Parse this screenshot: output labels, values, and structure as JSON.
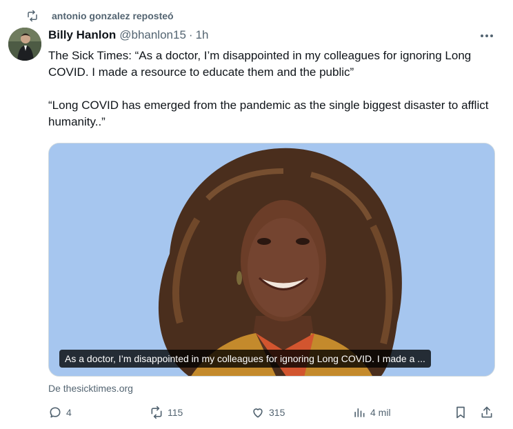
{
  "repost": {
    "text": "antonio gonzalez reposteó",
    "icon": "repost-icon"
  },
  "author": {
    "name": "Billy Hanlon",
    "handle": "@bhanlon15",
    "separator": "·",
    "time": "1h"
  },
  "tweet": {
    "paragraph1": "The Sick Times: “As a doctor, I’m disappointed in my colleagues for ignoring Long COVID. I made a resource to educate them and the public”",
    "paragraph2": "“Long COVID has emerged from the pandemic as the single biggest disaster to afflict humanity..”"
  },
  "card": {
    "caption": "As a doctor, I’m disappointed in my colleagues for ignoring Long COVID. I made a ...",
    "background_color": "#a6c6ef"
  },
  "source": "De thesicktimes.org",
  "actions": {
    "replies": "4",
    "reposts": "115",
    "likes": "315",
    "views": "4 mil"
  },
  "colors": {
    "text": "#0f1419",
    "secondary": "#536471"
  }
}
